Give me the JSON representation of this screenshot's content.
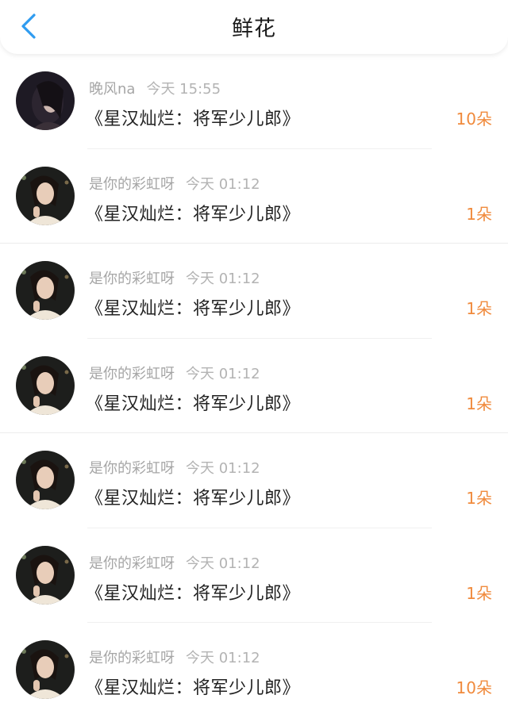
{
  "header": {
    "title": "鲜花",
    "back_icon": "chevron-left-icon",
    "accent_color": "#2f9cf0"
  },
  "count_color": "#f08a3c",
  "rows": [
    {
      "user": "晚风na",
      "time": "今天 15:55",
      "title": "《星汉灿烂：将军少儿郎》",
      "count": "10朵",
      "avatar": "avatar-photo-dark"
    },
    {
      "user": "是你的彩虹呀",
      "time": "今天 01:12",
      "title": "《星汉灿烂：将军少儿郎》",
      "count": "1朵",
      "avatar": "avatar-photo-light"
    },
    {
      "user": "是你的彩虹呀",
      "time": "今天 01:12",
      "title": "《星汉灿烂：将军少儿郎》",
      "count": "1朵",
      "avatar": "avatar-photo-light"
    },
    {
      "user": "是你的彩虹呀",
      "time": "今天 01:12",
      "title": "《星汉灿烂：将军少儿郎》",
      "count": "1朵",
      "avatar": "avatar-photo-light"
    },
    {
      "user": "是你的彩虹呀",
      "time": "今天 01:12",
      "title": "《星汉灿烂：将军少儿郎》",
      "count": "1朵",
      "avatar": "avatar-photo-light"
    },
    {
      "user": "是你的彩虹呀",
      "time": "今天 01:12",
      "title": "《星汉灿烂：将军少儿郎》",
      "count": "1朵",
      "avatar": "avatar-photo-light"
    },
    {
      "user": "是你的彩虹呀",
      "time": "今天 01:12",
      "title": "《星汉灿烂：将军少儿郎》",
      "count": "10朵",
      "avatar": "avatar-photo-light"
    }
  ]
}
